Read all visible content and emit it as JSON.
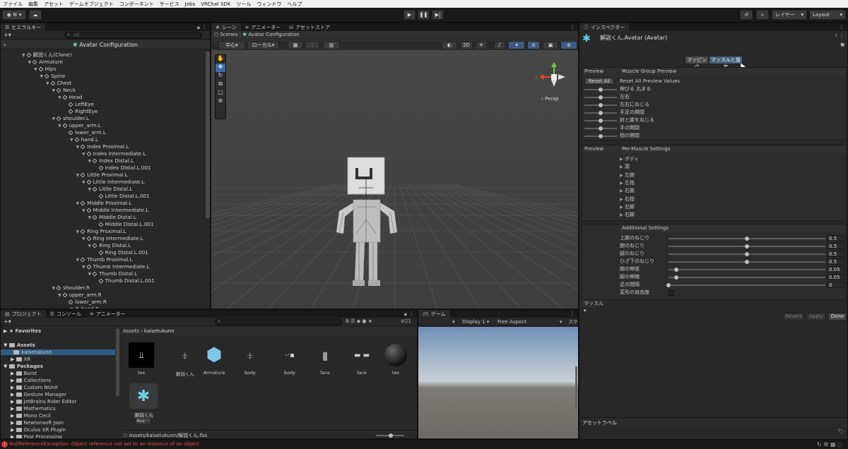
{
  "menubar": {
    "items": [
      "ファイル",
      "編集",
      "アセット",
      "ゲームオブジェクト",
      "コンポーネント",
      "サービス",
      "Jobs",
      "VRChat SDK",
      "ツール",
      "ウィンドウ",
      "ヘルプ"
    ]
  },
  "toolbar": {
    "account": "N",
    "layers": "レイヤー",
    "layout": "Layout"
  },
  "hierarchy": {
    "tab": "ヒエラルキー",
    "search_placeholder": "All",
    "header": "Avatar Configuration",
    "items": [
      {
        "label": "解説くん(Clone)",
        "d": 0
      },
      {
        "label": "Armature",
        "d": 1
      },
      {
        "label": "Hips",
        "d": 2
      },
      {
        "label": "Spine",
        "d": 3
      },
      {
        "label": "Chest",
        "d": 4
      },
      {
        "label": "Neck",
        "d": 5
      },
      {
        "label": "Head",
        "d": 6
      },
      {
        "label": "LeftEye",
        "d": 7
      },
      {
        "label": "RightEye",
        "d": 7
      },
      {
        "label": "shoulder.L",
        "d": 5
      },
      {
        "label": "upper_arm.L",
        "d": 6
      },
      {
        "label": "lower_arm.L",
        "d": 7
      },
      {
        "label": "hand.L",
        "d": 8
      },
      {
        "label": "Index Proximal.L",
        "d": 9
      },
      {
        "label": "Index Intermediate.L",
        "d": 10
      },
      {
        "label": "Index Distal.L",
        "d": 11
      },
      {
        "label": "Index Distal.L.001",
        "d": 12
      },
      {
        "label": "Little Proximal.L",
        "d": 9
      },
      {
        "label": "Little Intermediate.L",
        "d": 10
      },
      {
        "label": "Little Distal.L",
        "d": 11
      },
      {
        "label": "Little Distal.L.001",
        "d": 12
      },
      {
        "label": "Middle Proximal.L",
        "d": 9
      },
      {
        "label": "Middle Intermediate.L",
        "d": 10
      },
      {
        "label": "Middle Distal.L",
        "d": 11
      },
      {
        "label": "Middle Distal.L.001",
        "d": 12
      },
      {
        "label": "Ring Proximal.L",
        "d": 9
      },
      {
        "label": "Ring Intermediate.L",
        "d": 10
      },
      {
        "label": "Ring Distal.L",
        "d": 11
      },
      {
        "label": "Ring Distal.L.001",
        "d": 12
      },
      {
        "label": "Thumb Proximal.L",
        "d": 9
      },
      {
        "label": "Thumb Intermediate.L",
        "d": 10
      },
      {
        "label": "Thumb Distal.L",
        "d": 11
      },
      {
        "label": "Thumb Distal.L.001",
        "d": 12
      },
      {
        "label": "shoulder.R",
        "d": 5
      },
      {
        "label": "upper_arm.R",
        "d": 6
      },
      {
        "label": "lower_arm.R",
        "d": 7
      },
      {
        "label": "hand.R",
        "d": 8
      }
    ]
  },
  "scene": {
    "tabs": [
      "シーン",
      "アニメーター",
      "アセットストア"
    ],
    "breadcrumb_root": "Scenes",
    "breadcrumb_current": "Avatar Configuration",
    "pivot": "中心",
    "space": "ローカル",
    "mode2d": "2D",
    "persp": "Persp"
  },
  "inspector": {
    "tab": "インスペクター",
    "title": "解説くん.Avatar (Avatar)",
    "toggle_mapping": "マッピング",
    "toggle_muscles": "マッスルと設定",
    "preview": "Preview",
    "muscle_group_preview": "Muscle Group Preview",
    "reset_all": "Reset All",
    "reset_all_preview": "Reset All Preview Values",
    "group_sliders": [
      {
        "label": "伸びる 丸まる",
        "value": 0.5
      },
      {
        "label": "左右",
        "value": 0.5
      },
      {
        "label": "左右にねじる",
        "value": 0.5
      },
      {
        "label": "手足の開閉",
        "value": 0.5
      },
      {
        "label": "肘と膝をねじる",
        "value": 0.5
      },
      {
        "label": "手の開閉",
        "value": 0.5
      },
      {
        "label": "指の開閉",
        "value": 0.5
      }
    ],
    "per_muscle": "Per-Muscle Settings",
    "per_muscle_items": [
      "ボディ",
      "頭",
      "左腕",
      "左指",
      "右腕",
      "右指",
      "左脚",
      "右脚"
    ],
    "additional_settings": "Additional Settings",
    "additional": [
      {
        "label": "上腕のねじり",
        "value": "0.5",
        "frac": 0.5
      },
      {
        "label": "腕のねじり",
        "value": "0.5",
        "frac": 0.5
      },
      {
        "label": "腿のねじり",
        "value": "0.5",
        "frac": 0.5
      },
      {
        "label": "ひざ下のねじり",
        "value": "0.5",
        "frac": 0.5
      },
      {
        "label": "腕の伸張",
        "value": "0.05",
        "frac": 0.05
      },
      {
        "label": "脚の伸縮",
        "value": "0.05",
        "frac": 0.05
      },
      {
        "label": "足の間隔",
        "value": "0",
        "frac": 0
      }
    ],
    "freedom_label": "変形の自由度",
    "muscle_dropdown": "マッスル",
    "revert": "Revert",
    "apply": "Apply",
    "done": "Done",
    "asset_label": "アセットラベル"
  },
  "project": {
    "tabs": [
      "プロジェクト",
      "コンソール",
      "アニメーター"
    ],
    "count": "21",
    "favorites": "Favorites",
    "assets": "Assets",
    "assets_children": [
      "kaisetukunn",
      "XR"
    ],
    "packages": "Packages",
    "packages_children": [
      "Burst",
      "Collections",
      "Custom NUnit",
      "Gesture Manager",
      "JetBrains Rider Editor",
      "Mathematics",
      "Mono Cecil",
      "Newtonsoft Json",
      "Oculus XR Plugin",
      "Post Processing"
    ],
    "breadcrumb_root": "Assets",
    "breadcrumb_current": "kaisetukunn",
    "asset_items": [
      "tex",
      "解説くん",
      "Armature",
      "body",
      "body",
      "face",
      "face",
      "tex"
    ],
    "avatar_item": "解説くんAva···",
    "path": "Assets/kaisetukunn/解説くん.fbx"
  },
  "game": {
    "tab": "ゲーム",
    "display": "Display 1",
    "aspect": "Free Aspect",
    "scale": "スケ"
  },
  "status": {
    "error": "NullReferenceException: Object reference not set to an instance of an object"
  }
}
